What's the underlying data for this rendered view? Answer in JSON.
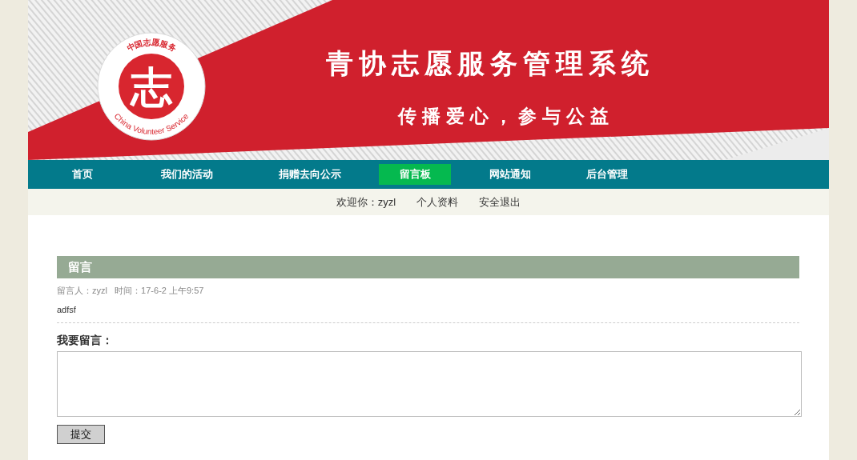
{
  "banner": {
    "logo": {
      "top_text": "中国志愿服务",
      "center_char": "志",
      "bottom_text": "China Volunteer Service"
    },
    "title": "青协志愿服务管理系统",
    "slogan": "传播爱心，参与公益"
  },
  "nav": [
    {
      "label": "首页",
      "selected": false
    },
    {
      "label": "我们的活动",
      "selected": false
    },
    {
      "label": "捐赠去向公示",
      "selected": false
    },
    {
      "label": "留言板",
      "selected": true
    },
    {
      "label": "网站通知",
      "selected": false
    },
    {
      "label": "后台管理",
      "selected": false
    }
  ],
  "user_bar": {
    "welcome": "欢迎你：zyzl",
    "links": [
      "个人资料",
      "安全退出"
    ]
  },
  "section_title": "留言",
  "messages": [
    {
      "meta": "留言人：zyzl   时间：17-6-2 上午9:57",
      "body": "adfsf"
    }
  ],
  "form": {
    "label": "我要留言：",
    "submit": "提交"
  }
}
